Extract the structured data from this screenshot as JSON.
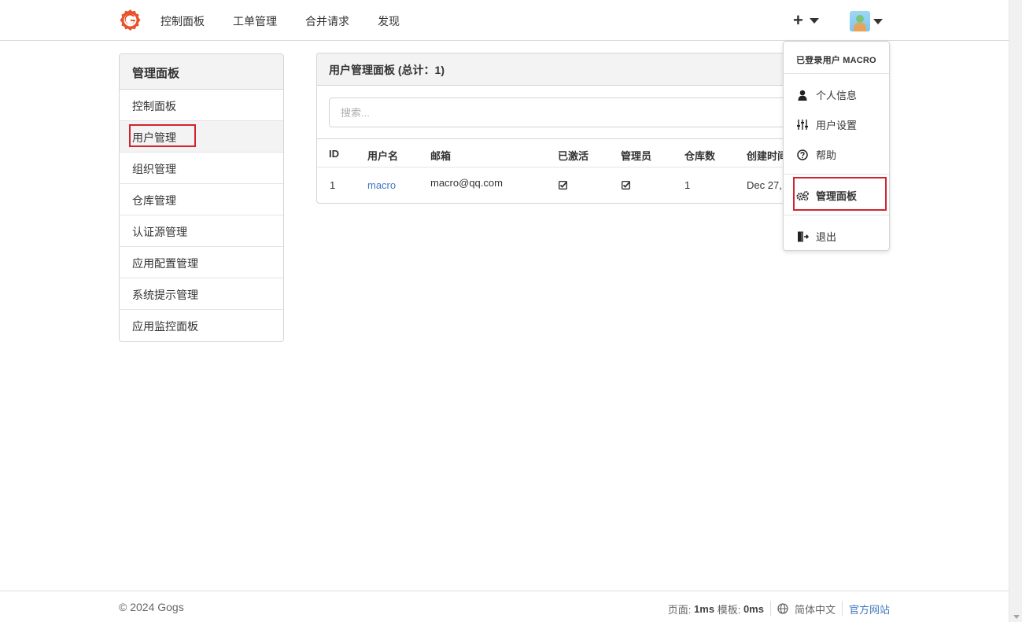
{
  "header": {
    "nav": [
      {
        "label": "控制面板"
      },
      {
        "label": "工单管理"
      },
      {
        "label": "合并请求"
      },
      {
        "label": "发现"
      }
    ],
    "plus_label": "+"
  },
  "sidebar": {
    "title": "管理面板",
    "items": [
      {
        "label": "控制面板"
      },
      {
        "label": "用户管理"
      },
      {
        "label": "组织管理"
      },
      {
        "label": "仓库管理"
      },
      {
        "label": "认证源管理"
      },
      {
        "label": "应用配置管理"
      },
      {
        "label": "系统提示管理"
      },
      {
        "label": "应用监控面板"
      }
    ]
  },
  "panel": {
    "title": "用户管理面板 (总计：1)",
    "search_placeholder": "搜索...",
    "columns": [
      "ID",
      "用户名",
      "邮箱",
      "已激活",
      "管理员",
      "仓库数",
      "创建时间"
    ],
    "rows": [
      {
        "id": "1",
        "username": "macro",
        "email": "macro@qq.com",
        "repos": "1",
        "created": "Dec 27,"
      }
    ]
  },
  "dropdown": {
    "header": "已登录用户 MACRO",
    "items": [
      {
        "label": "个人信息",
        "icon": "user-icon"
      },
      {
        "label": "用户设置",
        "icon": "sliders-icon"
      },
      {
        "label": "帮助",
        "icon": "help-circle-icon"
      },
      {
        "label": "管理面板",
        "icon": "cogs-icon"
      },
      {
        "label": "退出",
        "icon": "sign-out-icon"
      }
    ]
  },
  "footer": {
    "copyright": "© 2024 Gogs",
    "page_label": "页面:",
    "page_time": "1ms",
    "template_label": "模板:",
    "template_time": "0ms",
    "language": "简体中文",
    "website": "官方网站"
  },
  "colors": {
    "link": "#4078c0",
    "highlight": "#d0252f",
    "brand": "#e8512a"
  }
}
